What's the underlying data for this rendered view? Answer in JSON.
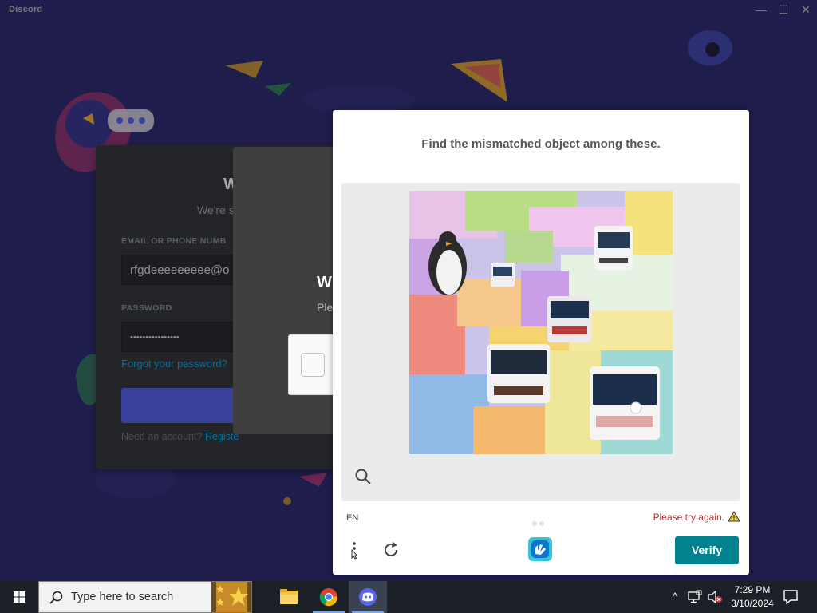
{
  "window": {
    "title": "Discord",
    "controls": {
      "minimize": "—",
      "maximize": "☐",
      "close": "✕"
    }
  },
  "login": {
    "heading": "W",
    "subheading": "We're s",
    "email_label": "EMAIL OR PHONE NUMB",
    "email_value": "rfgdeeeeeeeee@o",
    "password_label": "PASSWORD",
    "password_value": "••••••••••••••••",
    "forgot_link": "Forgot your password?",
    "need_account": "Need an account?",
    "register_link": "Registe"
  },
  "modal": {
    "heading": "W",
    "subheading": "Ple"
  },
  "captcha": {
    "prompt": "Find the mismatched object among these.",
    "language": "EN",
    "error": "Please try again.",
    "verify_label": "Verify",
    "accent_color": "#00838f",
    "error_color": "#b23030"
  },
  "taskbar": {
    "search_placeholder": "Type here to search",
    "clock_time": "7:29 PM",
    "clock_date": "3/10/2024",
    "pinned_apps": [
      "File Explorer",
      "Google Chrome",
      "Discord"
    ]
  }
}
